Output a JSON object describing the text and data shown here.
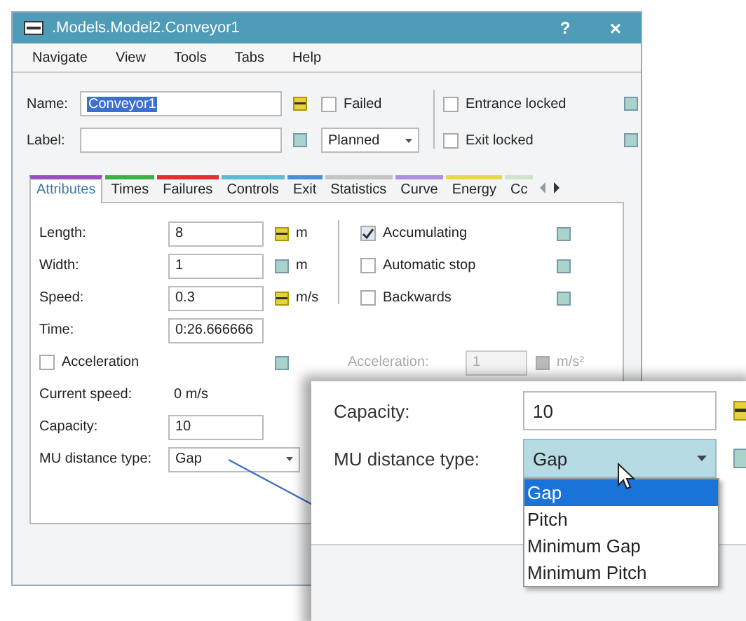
{
  "window": {
    "title": ".Models.Model2.Conveyor1",
    "help": "?",
    "close": "×"
  },
  "menu": [
    {
      "label": "Navigate"
    },
    {
      "label": "View"
    },
    {
      "label": "Tools"
    },
    {
      "label": "Tabs"
    },
    {
      "label": "Help"
    }
  ],
  "header": {
    "name": {
      "label": "Name:",
      "value": "Conveyor1",
      "modified": true
    },
    "label": {
      "label": "Label:",
      "modified": false
    },
    "failed": {
      "label": "Failed",
      "checked": false
    },
    "status": {
      "value": "Planned"
    },
    "entrance_locked": {
      "label": "Entrance locked",
      "checked": false,
      "modified": false
    },
    "exit_locked": {
      "label": "Exit locked",
      "checked": false,
      "modified": false
    }
  },
  "tabs": [
    {
      "label": "Attributes",
      "color": "#9b4fc0",
      "selected": true
    },
    {
      "label": "Times",
      "color": "#3cb043",
      "selected": false
    },
    {
      "label": "Failures",
      "color": "#e03030",
      "selected": false
    },
    {
      "label": "Controls",
      "color": "#5bbcd6",
      "selected": false
    },
    {
      "label": "Exit",
      "color": "#4a90d9",
      "selected": false
    },
    {
      "label": "Statistics",
      "color": "#c4c4c4",
      "selected": false
    },
    {
      "label": "Curve",
      "color": "#b08ee0",
      "selected": false
    },
    {
      "label": "Energy",
      "color": "#e8d84a",
      "selected": false
    },
    {
      "label": "Cc",
      "color": "#cfe3cf",
      "selected": false
    }
  ],
  "attributes": {
    "rows": [
      {
        "kind": "field",
        "label": "Length:",
        "value": "8",
        "modified": true,
        "unit": "m",
        "option": {
          "label": "Accumulating",
          "checked": true,
          "modified": false
        }
      },
      {
        "kind": "field",
        "label": "Width:",
        "value": "1",
        "modified": false,
        "unit": "m",
        "option": {
          "label": "Automatic stop",
          "checked": false,
          "modified": false
        }
      },
      {
        "kind": "field",
        "label": "Speed:",
        "value": "0.3",
        "modified": true,
        "unit": "m/s",
        "option": {
          "label": "Backwards",
          "checked": false,
          "modified": false
        }
      },
      {
        "kind": "field",
        "label": "Time:",
        "value": "0:26.666666"
      },
      {
        "kind": "checkbox",
        "label": "Acceleration",
        "checked": false,
        "modified": false,
        "related": {
          "label": "Acceleration:",
          "value": "1",
          "unit": "m/s²",
          "disabled": true
        }
      },
      {
        "kind": "reading",
        "label": "Current speed:",
        "value": "0 m/s"
      },
      {
        "kind": "field",
        "label": "Capacity:",
        "value": "10"
      },
      {
        "kind": "dropdown",
        "label": "MU distance type:",
        "value": "Gap"
      }
    ]
  },
  "zoom_inset": {
    "capacity": {
      "label": "Capacity:",
      "value": "10",
      "modified": true
    },
    "mu_distance": {
      "label": "MU distance type:",
      "value": "Gap",
      "modified": false
    },
    "options": [
      {
        "label": "Gap",
        "selected": true
      },
      {
        "label": "Pitch",
        "selected": false
      },
      {
        "label": "Minimum Gap",
        "selected": false
      },
      {
        "label": "Minimum Pitch",
        "selected": false
      }
    ]
  }
}
